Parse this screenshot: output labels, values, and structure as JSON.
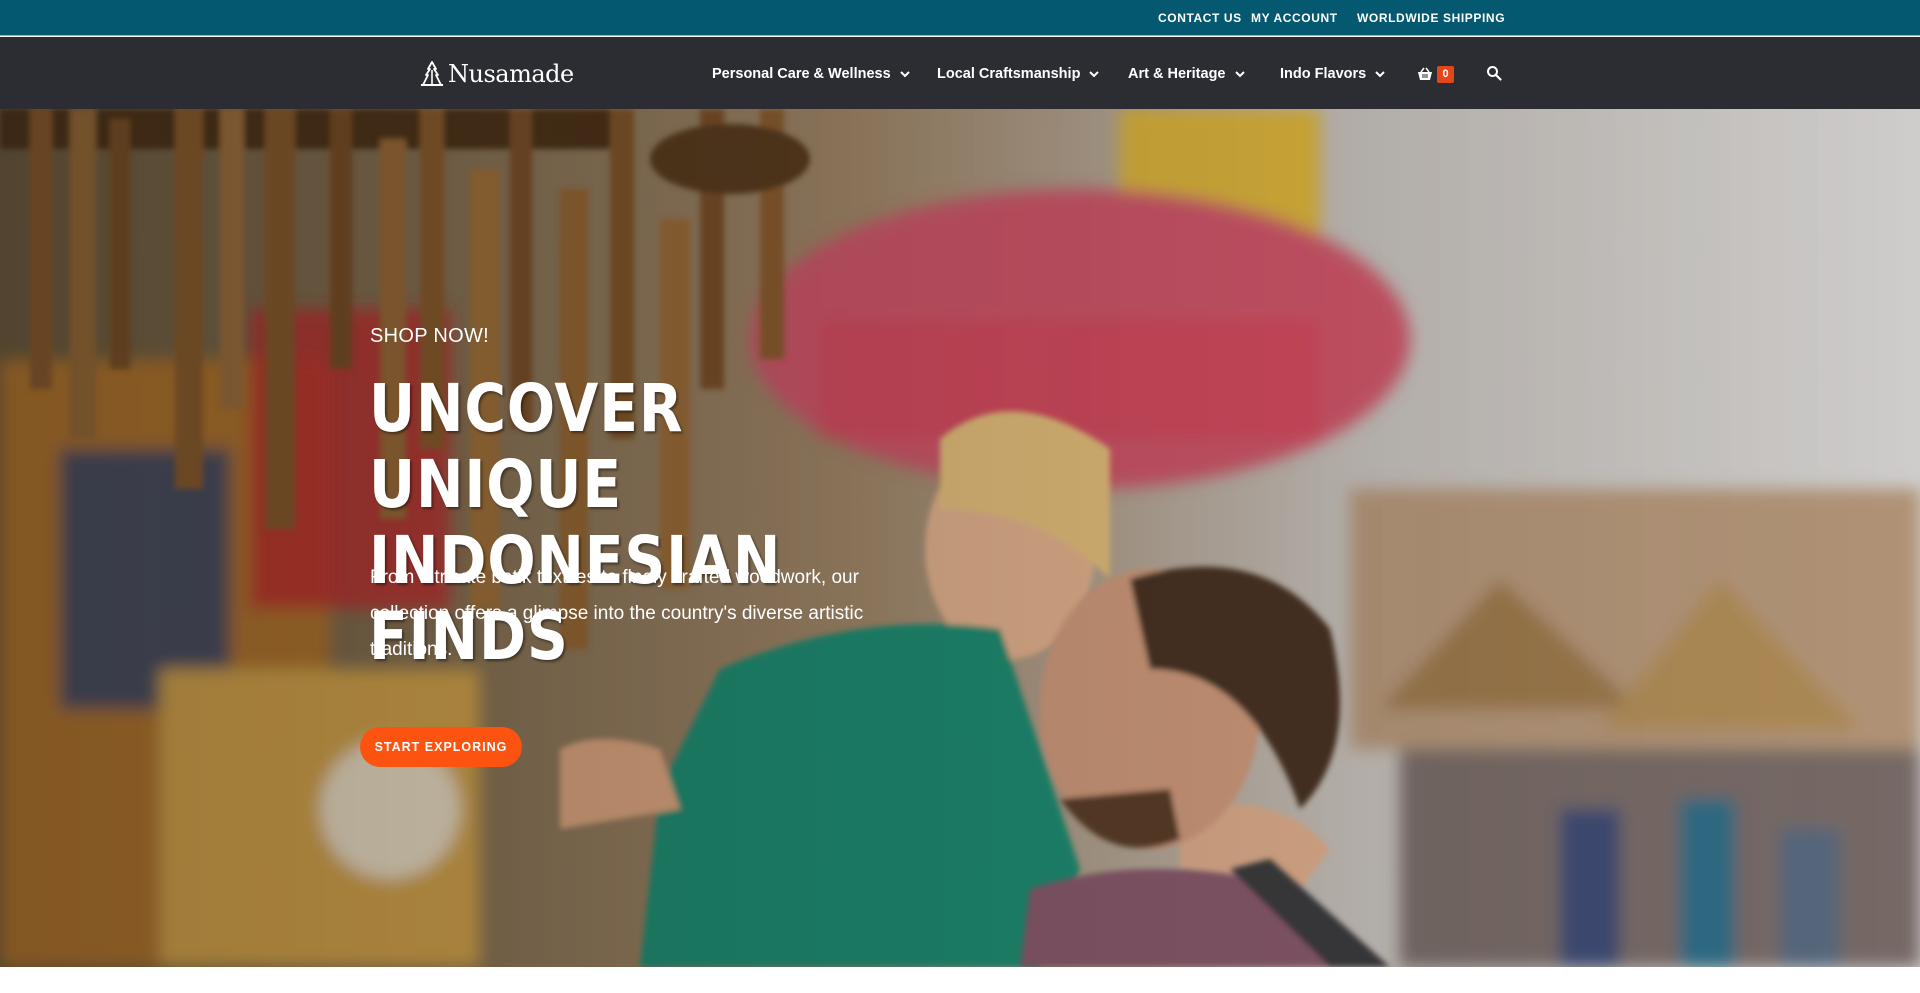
{
  "topbar": {
    "links": [
      "CONTACT US",
      "MY ACCOUNT",
      "WORLDWIDE SHIPPING"
    ]
  },
  "nav": {
    "logo_text": "Nusamade",
    "items": [
      {
        "label": "Personal Care & Wellness",
        "icon": "chevron-down-icon"
      },
      {
        "label": "Local Craftsmanship",
        "icon": "chevron-down-icon"
      },
      {
        "label": "Art & Heritage",
        "icon": "chevron-down-icon"
      },
      {
        "label": "Indo Flavors",
        "icon": "chevron-down-icon"
      }
    ],
    "cart_count": "0",
    "cart_icon": "basket-icon",
    "search_icon": "search-icon"
  },
  "hero": {
    "eyebrow": "SHOP NOW!",
    "headline_line1": "UNCOVER UNIQUE",
    "headline_line2": "INDONESIAN FINDS",
    "description": "From intricate batik textiles to finely crafted woodwork, our collection offers a glimpse into the country's diverse artistic traditions.",
    "cta_label": "START EXPLORING"
  },
  "colors": {
    "topbar": "#04586f",
    "navbar": "#2b2d33",
    "accent": "#fc5310",
    "cart_badge": "#e2471a"
  }
}
